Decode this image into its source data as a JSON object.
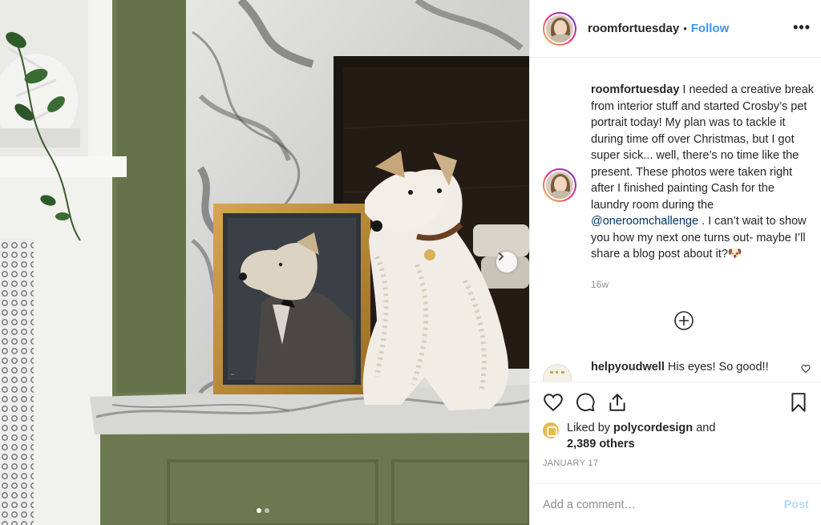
{
  "post": {
    "username": "roomfortuesday",
    "separator": "•",
    "follow_label": "Follow",
    "more_label": "•••"
  },
  "caption": {
    "username": "roomfortuesday",
    "text_before_mention": "I needed a creative break from interior stuff and started Crosby’s pet portrait today! My plan was to tackle it during time off over Christmas, but I got super sick... well, there’s no time like the present. These photos were taken right after I finished painting Cash for the laundry room during the",
    "mention": "@oneroomchallenge",
    "text_after_mention": ". I can’t wait to show you how my next one turns out- maybe I’ll share a blog post about it?🐶",
    "time_ago": "16w"
  },
  "comments": [
    {
      "username": "helpyoudwell",
      "text": "His eyes! So good!!"
    }
  ],
  "likes": {
    "prefix": "Liked by",
    "liker": "polycordesign",
    "suffix": "and",
    "others": "2,389 others"
  },
  "date": "JANUARY 17",
  "add_comment": {
    "placeholder": "Add a comment…",
    "post_label": "Post"
  },
  "carousel": {
    "total": 2,
    "active": 1
  },
  "icons": {
    "like": "heart-icon",
    "comment": "comment-bubble-icon",
    "share": "share-icon",
    "save": "bookmark-icon",
    "load_more": "plus-circle-icon",
    "next": "chevron-right-icon"
  },
  "colors": {
    "link_blue": "#3897f0",
    "post_disabled": "#b2dffc",
    "muted": "#8e8e8e"
  }
}
